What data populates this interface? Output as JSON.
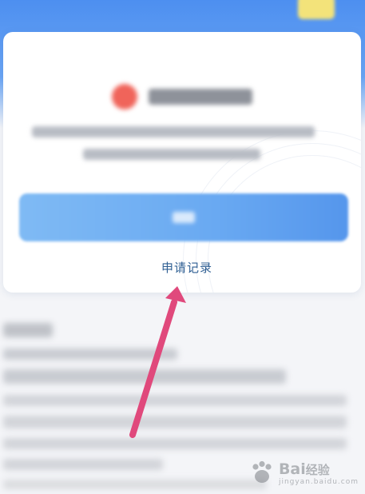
{
  "card": {
    "record_link_label": "申请记录"
  },
  "annotation": {
    "arrow_color": "#e0497c"
  },
  "watermark": {
    "brand": "Bai",
    "brand_tail": "经验",
    "sub": "jingyan.baidu.com"
  },
  "colors": {
    "accent_blue": "#4d8ff0",
    "button_blue": "#69a9f2",
    "link_blue": "#2f5f93",
    "status_red": "#f0645a"
  }
}
